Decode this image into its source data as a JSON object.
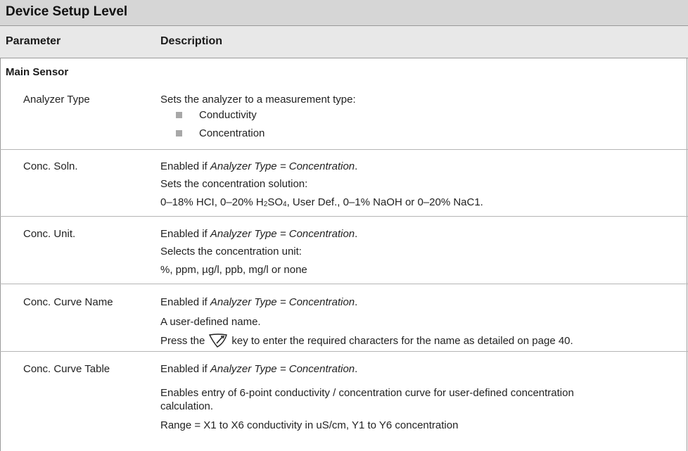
{
  "title": "Device Setup Level",
  "headers": {
    "parameter": "Parameter",
    "description": "Description"
  },
  "section": "Main Sensor",
  "rows": {
    "analyzer_type": {
      "name": "Analyzer Type",
      "line1": "Sets the analyzer to a measurement type:",
      "bullets": [
        "Conductivity",
        "Concentration"
      ]
    },
    "conc_soln": {
      "name": "Conc. Soln.",
      "enabled_prefix": "Enabled if ",
      "enabled_cond": "Analyzer Type = Concentration",
      "line2": "Sets the concentration solution:",
      "line3_a": "0–18% HCI, 0–20% H",
      "line3_sub1": "2",
      "line3_b": "SO",
      "line3_sub2": "4",
      "line3_c": ", User Def., 0–1% NaOH or 0–20% NaC1."
    },
    "conc_unit": {
      "name": "Conc. Unit.",
      "enabled_prefix": "Enabled if ",
      "enabled_cond": "Analyzer Type = Concentration",
      "line2": "Selects the concentration unit:",
      "line3": "%, ppm, µg/l, ppb, mg/l or none"
    },
    "conc_curve_name": {
      "name": "Conc. Curve Name",
      "enabled_prefix": "Enabled if ",
      "enabled_cond": "Analyzer Type = Concentration",
      "line2": "A user-defined name.",
      "line3_a": "Press the",
      "key_icon": "edit-key-icon",
      "line3_b": "key to enter the required characters for the name as detailed on page 40."
    },
    "conc_curve_table": {
      "name": "Conc. Curve Table",
      "enabled_prefix": "Enabled if ",
      "enabled_cond": "Analyzer Type = Concentration",
      "line2": "Enables entry of 6-point conductivity / concentration curve for user-defined concentration",
      "line3": "calculation.",
      "line4": "Range = X1 to X6 conductivity in uS/cm, Y1 to Y6 concentration"
    }
  }
}
